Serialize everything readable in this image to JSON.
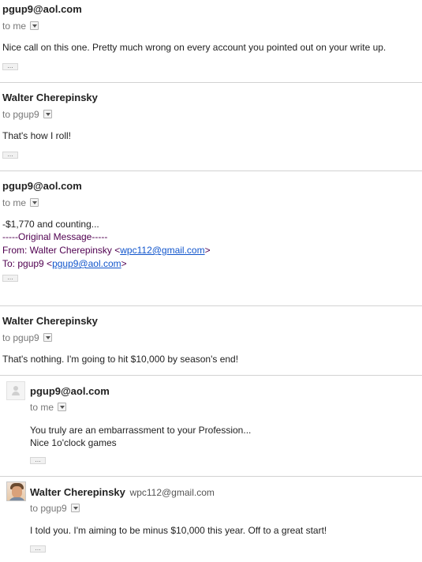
{
  "messages": [
    {
      "sender": "pgup9@aol.com",
      "to": "to me",
      "body": [
        "Nice call on this one. Pretty much wrong on every account you pointed out on your write up."
      ],
      "more": "..."
    },
    {
      "sender": "Walter Cherepinsky",
      "to": "to pgup9",
      "body": [
        "That's how I roll!"
      ],
      "more": "..."
    },
    {
      "sender": "pgup9@aol.com",
      "to": "to me",
      "body": [
        "-$1,770 and counting..."
      ],
      "original": {
        "header": "-----Original Message-----",
        "from_prefix": "From: Walter Cherepinsky <",
        "from_email": "wpc112@gmail.com",
        "from_suffix": ">",
        "to_prefix": "To: pgup9 <",
        "to_email": "pgup9@aol.com",
        "to_suffix": ">"
      },
      "more": "..."
    },
    {
      "sender": "Walter Cherepinsky",
      "to": "to pgup9",
      "body": [
        "That's nothing. I'm going to hit $10,000 by season's end!"
      ]
    },
    {
      "sender": "pgup9@aol.com",
      "to": "to me",
      "body": [
        "You  truly are an embarrassment to your Profession...",
        "Nice 1o'clock games"
      ],
      "more": "..."
    },
    {
      "sender": "Walter Cherepinsky",
      "sender_email": "wpc112@gmail.com",
      "to": "to pgup9",
      "body": [
        "I told you. I'm aiming to be minus $10,000 this year. Off to a great start!"
      ],
      "more": "..."
    }
  ],
  "icons": {
    "dropdown": "chevron-down-icon",
    "more": "ellipsis-icon",
    "default_avatar": "person-icon",
    "photo_avatar": "avatar-photo"
  }
}
